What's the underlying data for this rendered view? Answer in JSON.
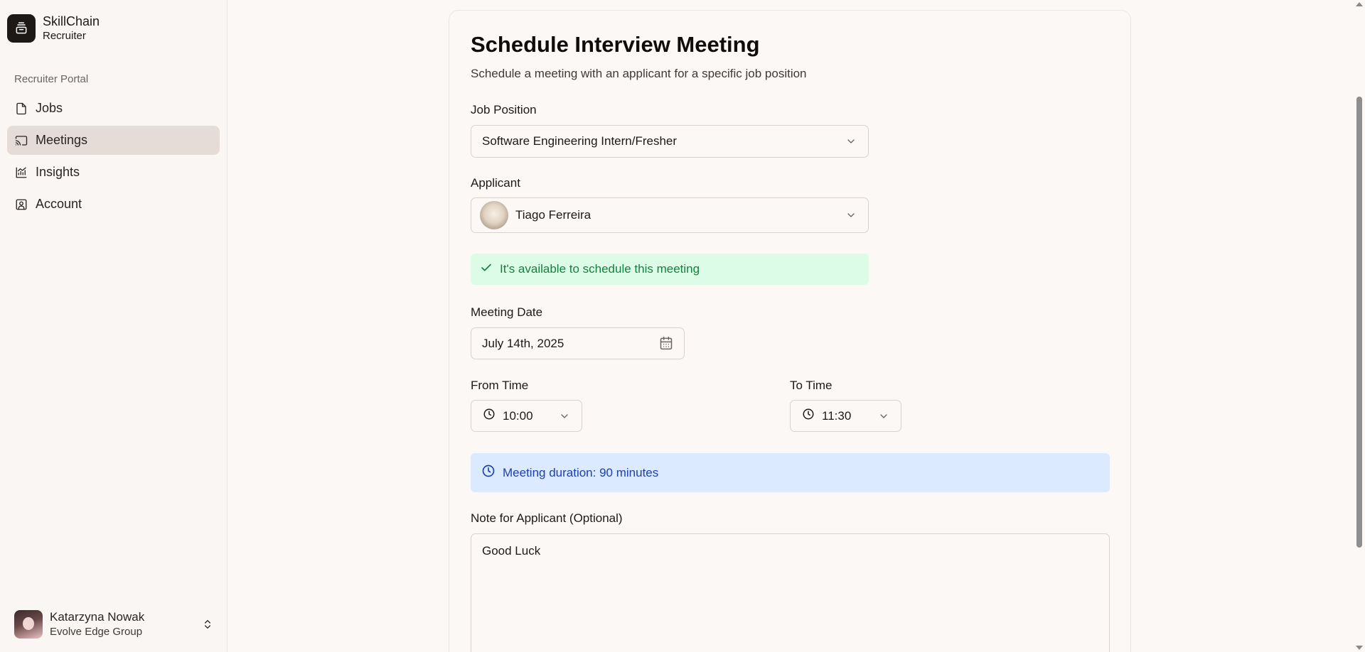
{
  "app": {
    "name": "SkillChain",
    "role": "Recruiter"
  },
  "sidebar": {
    "section_label": "Recruiter Portal",
    "items": [
      {
        "label": "Jobs",
        "icon": "file-icon",
        "active": false
      },
      {
        "label": "Meetings",
        "icon": "cast-icon",
        "active": true
      },
      {
        "label": "Insights",
        "icon": "chart-icon",
        "active": false
      },
      {
        "label": "Account",
        "icon": "contact-icon",
        "active": false
      }
    ],
    "user": {
      "name": "Katarzyna Nowak",
      "org": "Evolve Edge Group"
    }
  },
  "form": {
    "title": "Schedule Interview Meeting",
    "subtitle": "Schedule a meeting with an applicant for a specific job position",
    "job_position": {
      "label": "Job Position",
      "value": "Software Engineering Intern/Fresher"
    },
    "applicant": {
      "label": "Applicant",
      "value": "Tiago Ferreira"
    },
    "availability_message": "It's available to schedule this meeting",
    "meeting_date": {
      "label": "Meeting Date",
      "value": "July 14th, 2025"
    },
    "from_time": {
      "label": "From Time",
      "value": "10:00"
    },
    "to_time": {
      "label": "To Time",
      "value": "11:30"
    },
    "duration_message": "Meeting duration: 90 minutes",
    "note": {
      "label": "Note for Applicant (Optional)",
      "value": "Good Luck"
    }
  },
  "colors": {
    "success_bg": "#dcfce7",
    "success_text": "#15803d",
    "info_bg": "#dbeafe",
    "info_text": "#1e40af",
    "active_nav": "#e6dcd7"
  }
}
